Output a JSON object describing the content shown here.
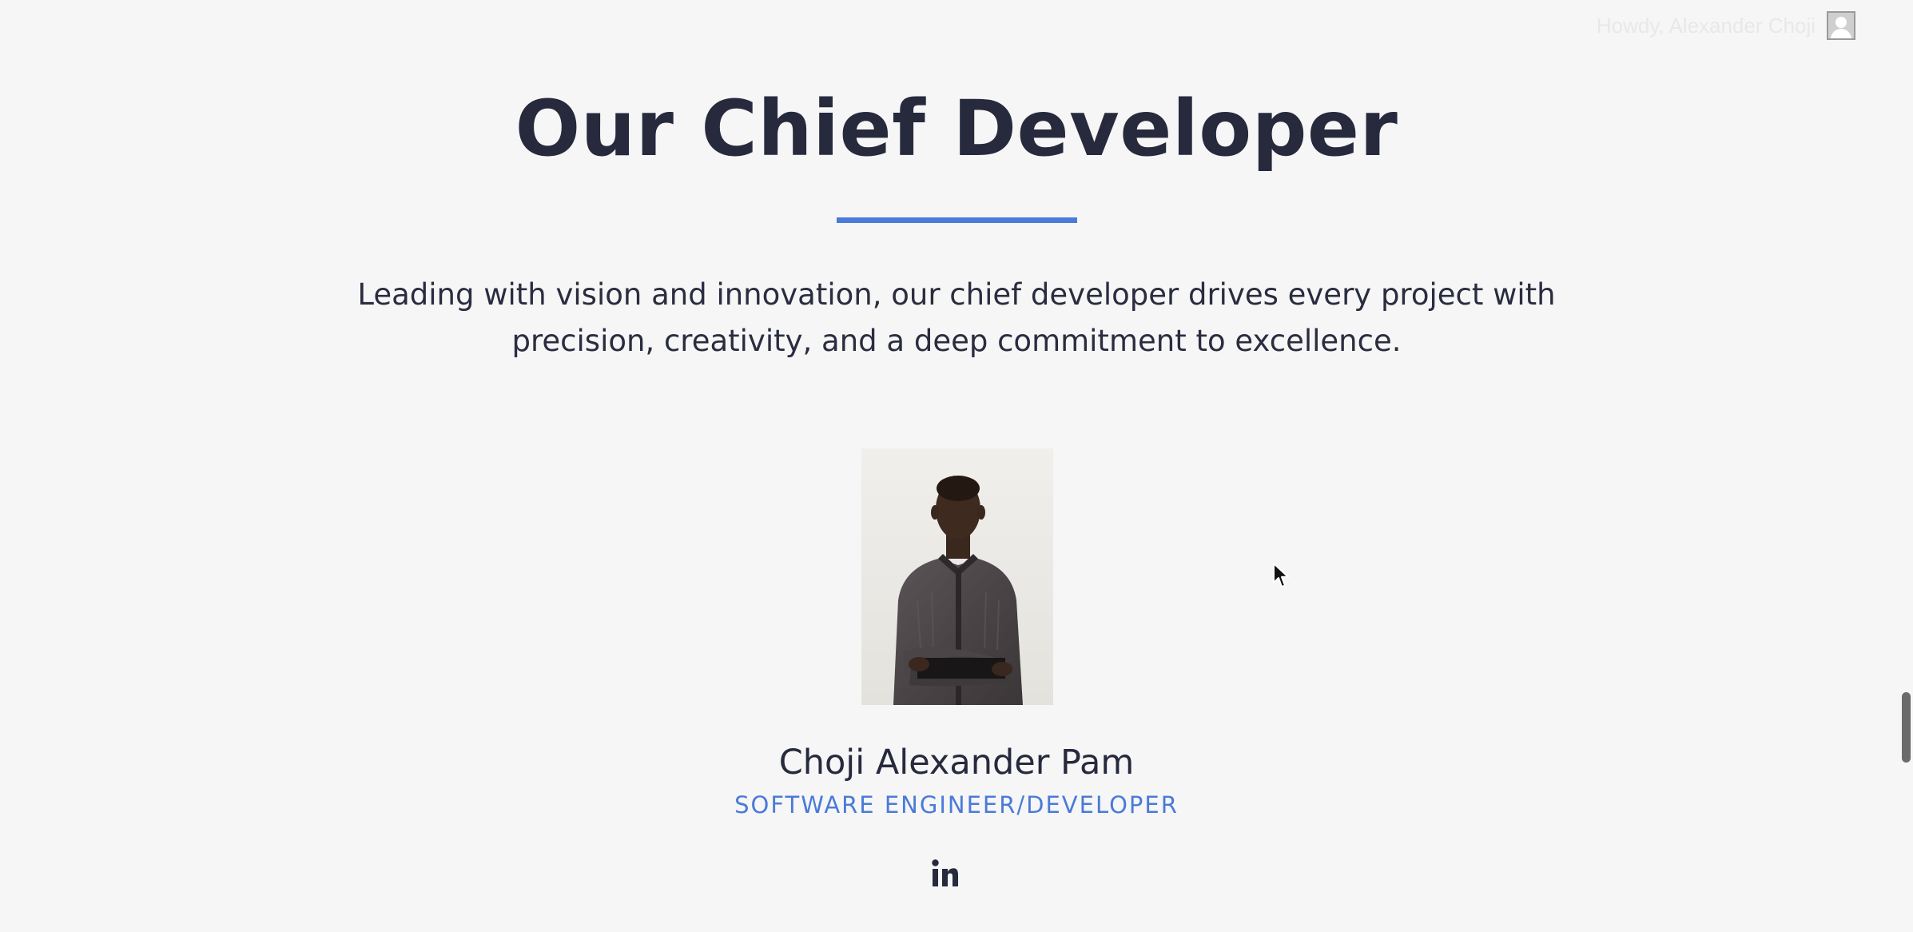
{
  "admin_bar": {
    "greeting": "Howdy, Alexander Choji",
    "avatar_icon": "user-avatar-icon"
  },
  "section": {
    "title": "Our Chief Developer",
    "lead": "Leading with vision and innovation, our chief developer drives every project with precision, creativity, and a deep commitment to excellence.",
    "accent_color": "#4b7ad8",
    "text_color": "#272a3d",
    "background_color": "#f6f6f6"
  },
  "member": {
    "name": "Choji Alexander Pam",
    "role": "SOFTWARE ENGINEER/DEVELOPER",
    "social_icon": "linkedin-icon"
  }
}
